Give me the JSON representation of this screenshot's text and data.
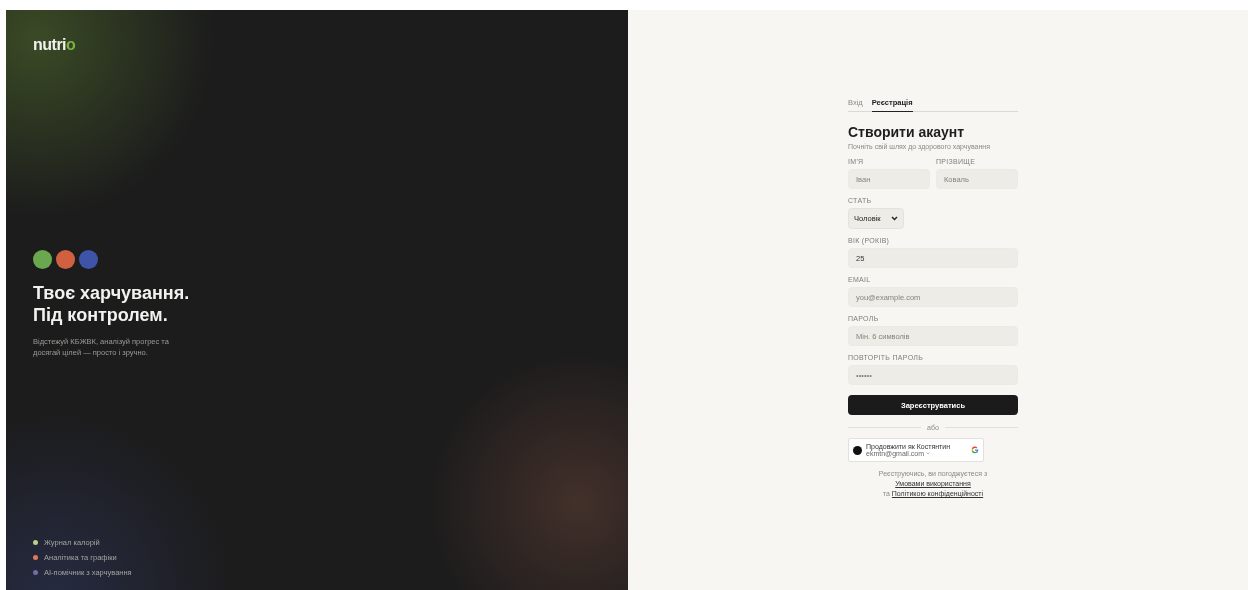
{
  "brand": {
    "logo_main": "nutri",
    "logo_accent": "o"
  },
  "hero": {
    "dots": [
      {
        "color": "#6aa84f"
      },
      {
        "color": "#d0603f"
      },
      {
        "color": "#3d54a8"
      }
    ],
    "title_lines": [
      "Твоє харчування.",
      "Під контролем."
    ],
    "subtitle": "Відстежуй КБЖВК, аналізуй прогрес та досягай цілей — просто і зручно."
  },
  "features": [
    {
      "label": "Журнал калорій",
      "color": "#b8d08a"
    },
    {
      "label": "Аналітика та графіки",
      "color": "#e07a5a"
    },
    {
      "label": "AI-помічник з харчування",
      "color": "#6a6fa8"
    }
  ],
  "tabs": [
    {
      "label": "Вхід",
      "selected": false
    },
    {
      "label": "Реєстрація",
      "selected": true
    }
  ],
  "form": {
    "title": "Створити акаунт",
    "subtitle": "Почніть свій шлях до здорового харчування",
    "first_name": {
      "label": "ІМ'Я",
      "placeholder": "Іван"
    },
    "last_name": {
      "label": "ПРІЗВИЩЕ",
      "placeholder": "Коваль"
    },
    "gender": {
      "label": "СТАТЬ",
      "value": "Чоловік"
    },
    "age": {
      "label": "ВІК (РОКІВ)",
      "value": "25"
    },
    "email": {
      "label": "EMAIL",
      "placeholder": "you@example.com"
    },
    "password": {
      "label": "ПАРОЛЬ",
      "placeholder": "Мін. 6 символів"
    },
    "repeat": {
      "label": "ПОВТОРІТЬ ПАРОЛЬ",
      "placeholder": "••••••"
    },
    "submit": "Зареєструватись",
    "divider": "або",
    "google": {
      "name": "Продовжити як Костянтин",
      "email": "ekmtn@gmail.com"
    },
    "terms": {
      "before": "Реєструючись, ви погоджуєтеся з",
      "link1": "Умовами використання",
      "middle": "та",
      "link2": "Політикою конфіденційності"
    }
  }
}
